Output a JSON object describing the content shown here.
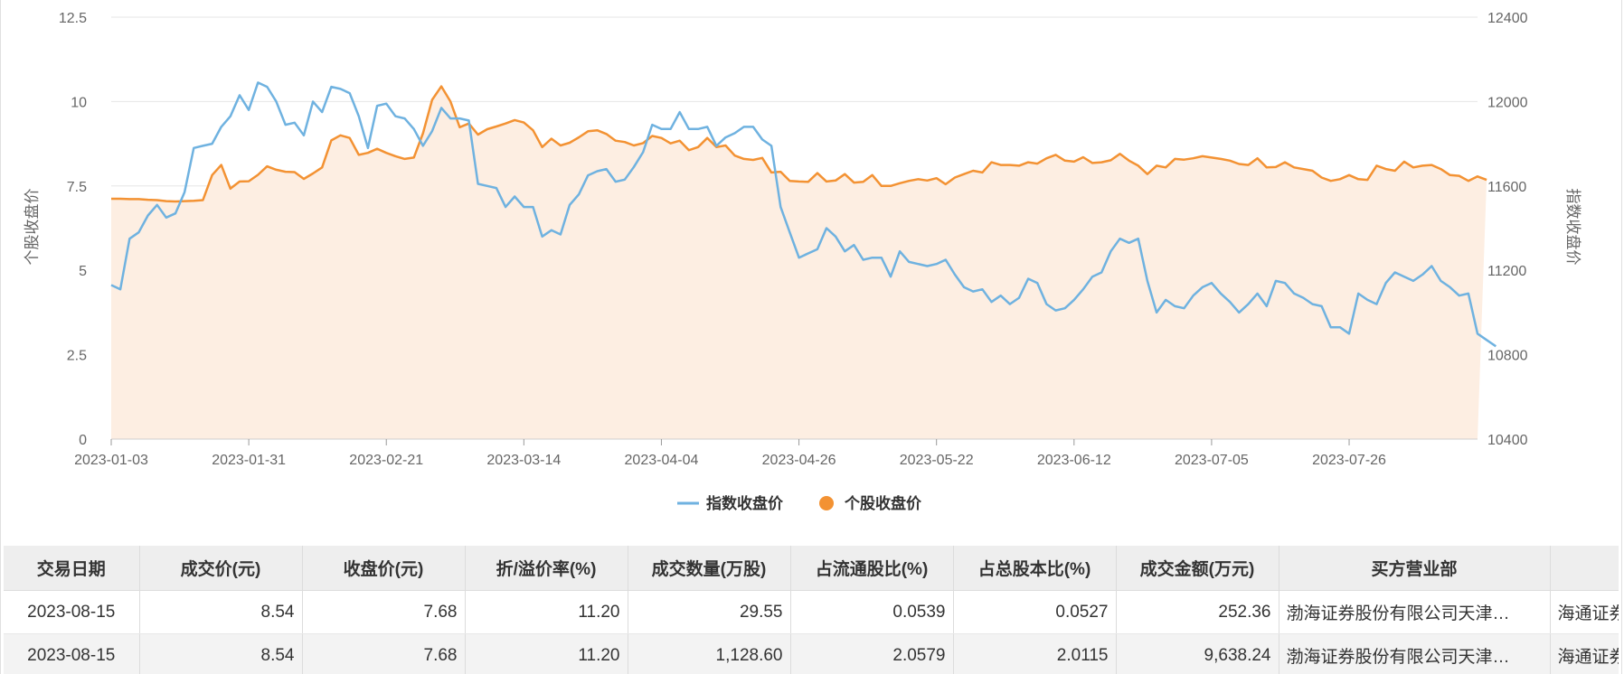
{
  "chart_data": {
    "type": "line",
    "x": [
      "2023-01-03",
      "2023-01-04",
      "2023-01-05",
      "2023-01-06",
      "2023-01-09",
      "2023-01-10",
      "2023-01-11",
      "2023-01-12",
      "2023-01-13",
      "2023-01-16",
      "2023-01-17",
      "2023-01-18",
      "2023-01-19",
      "2023-01-20",
      "2023-01-30",
      "2023-01-31",
      "2023-02-01",
      "2023-02-02",
      "2023-02-03",
      "2023-02-06",
      "2023-02-07",
      "2023-02-08",
      "2023-02-09",
      "2023-02-10",
      "2023-02-13",
      "2023-02-14",
      "2023-02-15",
      "2023-02-16",
      "2023-02-17",
      "2023-02-20",
      "2023-02-21",
      "2023-02-22",
      "2023-02-23",
      "2023-02-24",
      "2023-02-27",
      "2023-02-28",
      "2023-03-01",
      "2023-03-02",
      "2023-03-03",
      "2023-03-06",
      "2023-03-07",
      "2023-03-08",
      "2023-03-09",
      "2023-03-10",
      "2023-03-13",
      "2023-03-14",
      "2023-03-15",
      "2023-03-16",
      "2023-03-17",
      "2023-03-20",
      "2023-03-21",
      "2023-03-22",
      "2023-03-23",
      "2023-03-24",
      "2023-03-27",
      "2023-03-28",
      "2023-03-29",
      "2023-03-30",
      "2023-03-31",
      "2023-04-03",
      "2023-04-04",
      "2023-04-06",
      "2023-04-07",
      "2023-04-10",
      "2023-04-11",
      "2023-04-12",
      "2023-04-13",
      "2023-04-14",
      "2023-04-17",
      "2023-04-18",
      "2023-04-19",
      "2023-04-20",
      "2023-04-21",
      "2023-04-24",
      "2023-04-25",
      "2023-04-26",
      "2023-04-27",
      "2023-04-28",
      "2023-05-04",
      "2023-05-05",
      "2023-05-08",
      "2023-05-09",
      "2023-05-10",
      "2023-05-11",
      "2023-05-12",
      "2023-05-15",
      "2023-05-16",
      "2023-05-17",
      "2023-05-18",
      "2023-05-19",
      "2023-05-22",
      "2023-05-23",
      "2023-05-24",
      "2023-05-25",
      "2023-05-26",
      "2023-05-29",
      "2023-05-30",
      "2023-05-31",
      "2023-06-01",
      "2023-06-02",
      "2023-06-05",
      "2023-06-06",
      "2023-06-07",
      "2023-06-08",
      "2023-06-09",
      "2023-06-12",
      "2023-06-13",
      "2023-06-14",
      "2023-06-15",
      "2023-06-16",
      "2023-06-19",
      "2023-06-20",
      "2023-06-21",
      "2023-06-26",
      "2023-06-27",
      "2023-06-28",
      "2023-06-29",
      "2023-06-30",
      "2023-07-03",
      "2023-07-04",
      "2023-07-05",
      "2023-07-06",
      "2023-07-07",
      "2023-07-10",
      "2023-07-11",
      "2023-07-12",
      "2023-07-13",
      "2023-07-14",
      "2023-07-17",
      "2023-07-18",
      "2023-07-19",
      "2023-07-20",
      "2023-07-21",
      "2023-07-24",
      "2023-07-25",
      "2023-07-26",
      "2023-07-27",
      "2023-07-28",
      "2023-07-31",
      "2023-08-01",
      "2023-08-02",
      "2023-08-03",
      "2023-08-04",
      "2023-08-07",
      "2023-08-08",
      "2023-08-09",
      "2023-08-10",
      "2023-08-11",
      "2023-08-14",
      "2023-08-15"
    ],
    "x_ticks": [
      "2023-01-03",
      "2023-01-31",
      "2023-02-21",
      "2023-03-14",
      "2023-04-04",
      "2023-04-26",
      "2023-05-22",
      "2023-06-12",
      "2023-07-05",
      "2023-07-26"
    ],
    "series": [
      {
        "name": "指数收盘价",
        "axis": "right",
        "color": "#6fb2e0",
        "style": "line",
        "values": [
          11130,
          11110,
          11350,
          11380,
          11460,
          11510,
          11450,
          11470,
          11570,
          11780,
          11790,
          11800,
          11880,
          11930,
          12030,
          11960,
          12090,
          12070,
          12000,
          11890,
          11900,
          11840,
          12000,
          11950,
          12070,
          12060,
          12040,
          11930,
          11780,
          11980,
          11990,
          11930,
          11920,
          11870,
          11790,
          11860,
          11970,
          11920,
          11920,
          11910,
          11610,
          11600,
          11590,
          11500,
          11550,
          11500,
          11500,
          11360,
          11390,
          11370,
          11510,
          11560,
          11650,
          11670,
          11680,
          11620,
          11630,
          11690,
          11760,
          11890,
          11870,
          11870,
          11950,
          11870,
          11870,
          11880,
          11790,
          11830,
          11850,
          11880,
          11880,
          11820,
          11790,
          11500,
          11380,
          11260,
          11280,
          11300,
          11400,
          11360,
          11290,
          11320,
          11250,
          11260,
          11260,
          11170,
          11290,
          11240,
          11230,
          11220,
          11230,
          11250,
          11180,
          11120,
          11100,
          11110,
          11050,
          11080,
          11040,
          11070,
          11160,
          11140,
          11040,
          11010,
          11020,
          11060,
          11110,
          11170,
          11190,
          11290,
          11350,
          11330,
          11350,
          11150,
          11000,
          11060,
          11030,
          11020,
          11080,
          11120,
          11140,
          11090,
          11050,
          11000,
          11040,
          11090,
          11030,
          11150,
          11140,
          11090,
          11070,
          11040,
          11030,
          10930,
          10930,
          10900,
          11090,
          11060,
          11040,
          11140,
          11190,
          11170,
          11150,
          11180,
          11220,
          11150,
          11120,
          11080,
          11090,
          10900,
          10870,
          10840
        ],
        "dates_for_values": "x"
      },
      {
        "name": "个股收盘价",
        "axis": "left",
        "color": "#f39233",
        "style": "area",
        "values": [
          7.12,
          7.12,
          7.11,
          7.11,
          7.09,
          7.08,
          7.05,
          7.04,
          7.05,
          7.06,
          7.08,
          7.82,
          8.12,
          7.42,
          7.63,
          7.64,
          7.83,
          8.08,
          7.98,
          7.92,
          7.91,
          7.71,
          7.87,
          8.05,
          8.85,
          9.0,
          8.92,
          8.42,
          8.48,
          8.6,
          8.48,
          8.38,
          8.3,
          8.34,
          9.06,
          10.05,
          10.45,
          10.0,
          9.24,
          9.35,
          9.02,
          9.18,
          9.26,
          9.35,
          9.45,
          9.38,
          9.15,
          8.65,
          8.9,
          8.7,
          8.78,
          8.94,
          9.12,
          9.15,
          9.04,
          8.84,
          8.8,
          8.7,
          8.77,
          8.98,
          8.92,
          8.76,
          8.84,
          8.56,
          8.65,
          8.92,
          8.65,
          8.7,
          8.4,
          8.3,
          8.27,
          8.33,
          7.9,
          7.92,
          7.65,
          7.63,
          7.62,
          7.88,
          7.63,
          7.66,
          7.85,
          7.6,
          7.62,
          7.82,
          7.5,
          7.5,
          7.58,
          7.65,
          7.7,
          7.66,
          7.73,
          7.55,
          7.75,
          7.85,
          7.95,
          7.9,
          8.2,
          8.12,
          8.12,
          8.1,
          8.2,
          8.16,
          8.32,
          8.42,
          8.25,
          8.22,
          8.35,
          8.18,
          8.2,
          8.26,
          8.45,
          8.25,
          8.1,
          7.85,
          8.1,
          8.05,
          8.3,
          8.28,
          8.32,
          8.38,
          8.34,
          8.3,
          8.25,
          8.15,
          8.12,
          8.32,
          8.05,
          8.06,
          8.2,
          8.05,
          8.0,
          7.95,
          7.75,
          7.65,
          7.7,
          7.82,
          7.7,
          7.68,
          8.1,
          8.0,
          7.95,
          8.22,
          8.05,
          8.1,
          8.12,
          8.0,
          7.82,
          7.8,
          7.65,
          7.78,
          7.68
        ]
      }
    ],
    "y_left": {
      "label": "个股收盘价",
      "ylim": [
        0,
        12.5
      ],
      "ticks": [
        "0",
        "2.5",
        "5",
        "7.5",
        "10",
        "12.5"
      ]
    },
    "y_right": {
      "label": "指数收盘价",
      "ylim": [
        10400,
        12400
      ],
      "ticks": [
        "10400",
        "10800",
        "11200",
        "11600",
        "12000",
        "12400"
      ]
    },
    "grid": true,
    "legend_position": "bottom-center"
  },
  "colors": {
    "index_line": "#6fb2e0",
    "stock_line": "#f39233",
    "stock_area": "#fdeee2",
    "grid": "#e6e6e6"
  },
  "legend": {
    "index_label": "指数收盘价",
    "stock_label": "个股收盘价"
  },
  "table": {
    "headers": [
      "交易日期",
      "成交价(元)",
      "收盘价(元)",
      "折/溢价率(%)",
      "成交数量(万股)",
      "占流通股比(%)",
      "占总股本比(%)",
      "成交金额(万元)",
      "买方营业部",
      ""
    ],
    "rows": [
      [
        "2023-08-15",
        "8.54",
        "7.68",
        "11.20",
        "29.55",
        "0.0539",
        "0.0527",
        "252.36",
        "渤海证券股份有限公司天津…",
        "海通证券"
      ],
      [
        "2023-08-15",
        "8.54",
        "7.68",
        "11.20",
        "1,128.60",
        "2.0579",
        "2.0115",
        "9,638.24",
        "渤海证券股份有限公司天津…",
        "海通证券"
      ]
    ]
  }
}
